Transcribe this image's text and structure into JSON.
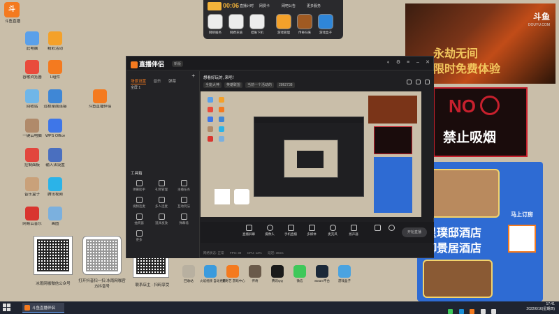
{
  "corner": {
    "label": "斗鱼直播"
  },
  "desktop_icons": [
    {
      "label": "此电脑",
      "color": "#5aa0ea"
    },
    {
      "label": "精彩活动",
      "color": "#f4a12a"
    },
    {
      "label": "谷歌浏览器",
      "color": "#e94b3c"
    },
    {
      "label": "L组件",
      "color": "#f47a1f"
    },
    {
      "label": "回收站",
      "color": "#6fb6e8"
    },
    {
      "label": "远程桌面连接",
      "color": "#3f87d6"
    },
    {
      "label": "斗鱼直播伴侣",
      "color": "#f47a1f"
    },
    {
      "label": "一键云电脑",
      "color": "#b08a6a"
    },
    {
      "label": "WPS Office",
      "color": "#3e76e8"
    },
    {
      "label": "控制面板",
      "color": "#e2463d"
    },
    {
      "label": "输入法设置",
      "color": "#4a6fbf"
    },
    {
      "label": "音乐盒子",
      "color": "#c9a17a"
    },
    {
      "label": "腾讯视频",
      "color": "#2bb3e8"
    },
    {
      "label": "网易云音乐",
      "color": "#d9352f"
    },
    {
      "label": "画图",
      "color": "#7bb0de"
    }
  ],
  "topbar": {
    "time": "00:06",
    "links": [
      "直播计时",
      "网费卡",
      "网吧公告",
      "更多服务"
    ],
    "buttons": [
      {
        "label": "网吧服务",
        "icon": "service-icon"
      },
      {
        "label": "网费充值",
        "icon": "coin-icon"
      },
      {
        "label": "结账下机",
        "icon": "power-icon"
      },
      {
        "label": "游戏管理",
        "icon": "game-icon"
      },
      {
        "label": "传奇归来",
        "icon": "legend-icon"
      },
      {
        "label": "游戏盒子",
        "icon": "box-icon"
      }
    ]
  },
  "app": {
    "title": "直播伴侣",
    "version": "新版",
    "left_tabs": [
      "场景设置",
      "音乐",
      "弹幕"
    ],
    "scene": "全屏 1",
    "tools_title": "工具箱",
    "tools": [
      "弹幕助手",
      "礼物管理",
      "主播任务",
      "视频连麦",
      "多人连麦",
      "互动玩法",
      "抽奖器",
      "道具发放",
      "弹幕墙",
      "更多"
    ],
    "room_title": "想看好玩的, 来吧！",
    "room_tags": [
      "全能大神",
      "英雄联盟",
      "当前一个活动的",
      "2862738"
    ],
    "bottom_buttons": [
      "直播屏幕",
      "摄像头",
      "手机直播",
      "多媒体",
      "麦克风",
      "扬声器"
    ],
    "start_live": "开始直播",
    "footer": [
      "网络状态: 正常",
      "FPS: 30",
      "CPU: 12%",
      "延迟: 36ms"
    ]
  },
  "ads": {
    "game_line1": "永劫无间",
    "game_line2": "限时免费体验",
    "brand": "斗鱼",
    "brand_sub": "DOUYU.COM",
    "no_smoking_no": "NO",
    "no_smoking_text": "禁止吸烟",
    "hotel_line1": "星璞邸酒店",
    "hotel_line2": "御景居酒店",
    "hotel_qr_label": "马上订房"
  },
  "qr_labels": [
    "冰雨网咖微信公众号",
    "打开抖音扫一扫 冰雨网咖官方抖音号",
    "联系店主 · 扫码享受"
  ],
  "dock": [
    {
      "label": "回收站",
      "color": "#b8b0a0"
    },
    {
      "label": "火焰视频 自动更新",
      "color": "#3b9bdd"
    },
    {
      "label": "爱奇艺 游戏中心",
      "color": "#f47a1f"
    },
    {
      "label": "传奇",
      "color": "#6a5a4a"
    },
    {
      "label": "腾讯QQ",
      "color": "#1a1a1a"
    },
    {
      "label": "微信",
      "color": "#3ec85a"
    },
    {
      "label": "Steam平台",
      "color": "#1b2838"
    },
    {
      "label": "游戏盒子",
      "color": "#4aa3e0"
    }
  ],
  "taskbar": {
    "app": "斗鱼直播伴侣",
    "time": "17:41",
    "date": "2022/6/16(星期四)"
  }
}
